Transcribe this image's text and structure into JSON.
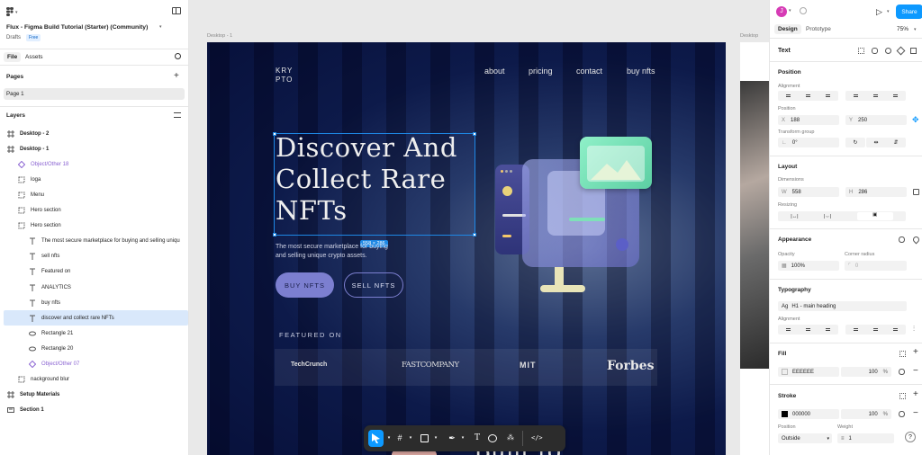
{
  "file": {
    "title": "Flux - Figma Build Tutorial (Starter) (Community)",
    "location": "Drafts",
    "plan_badge": "Free"
  },
  "left_tabs": [
    "File",
    "Assets"
  ],
  "pages": {
    "header": "Pages",
    "items": [
      "Page 1"
    ]
  },
  "layers": {
    "header": "Layers",
    "items": [
      {
        "label": "Desktop - 2",
        "indent": 0,
        "icon": "frame-icon",
        "bold": true
      },
      {
        "label": "Desktop - 1",
        "indent": 0,
        "icon": "frame-icon",
        "bold": true
      },
      {
        "label": "Object/Other 18",
        "indent": 1,
        "icon": "component-instance-icon",
        "purple": true
      },
      {
        "label": "loga",
        "indent": 1,
        "icon": "group-icon"
      },
      {
        "label": "Menu",
        "indent": 1,
        "icon": "group-icon"
      },
      {
        "label": "Hero section",
        "indent": 1,
        "icon": "group-icon"
      },
      {
        "label": "Hero section",
        "indent": 1,
        "icon": "group-icon"
      },
      {
        "label": "The most secure marketplace for buying and selling uniqu",
        "indent": 2,
        "icon": "text-icon"
      },
      {
        "label": "sell nfts",
        "indent": 2,
        "icon": "text-icon"
      },
      {
        "label": "Featured on",
        "indent": 2,
        "icon": "text-icon"
      },
      {
        "label": "ANALYTICS",
        "indent": 2,
        "icon": "text-icon"
      },
      {
        "label": "buy nfts",
        "indent": 2,
        "icon": "text-icon"
      },
      {
        "label": "discover and collect rare NFTs",
        "indent": 2,
        "icon": "text-icon",
        "selected": true
      },
      {
        "label": "Rectangle 21",
        "indent": 2,
        "icon": "ellipse-icon"
      },
      {
        "label": "Rectangle 20",
        "indent": 2,
        "icon": "ellipse-icon"
      },
      {
        "label": "Object/Other 07",
        "indent": 2,
        "icon": "component-instance-icon",
        "purple": true
      },
      {
        "label": "nackground blur",
        "indent": 1,
        "icon": "group-icon"
      },
      {
        "label": "Setup Materials",
        "indent": 0,
        "icon": "frame-icon",
        "bold": true
      },
      {
        "label": "Section 1",
        "indent": 0,
        "icon": "section-icon",
        "bold": true
      }
    ]
  },
  "canvas": {
    "frame_label_1": "Desktop - 1",
    "frame_label_2": "Desktop"
  },
  "site": {
    "logo": [
      "KRY",
      "PTO"
    ],
    "nav": [
      "about",
      "pricing",
      "contact",
      "buy nfts"
    ],
    "heading": [
      "Discover And",
      "Collect Rare",
      "NFTs"
    ],
    "subtext": [
      "The most secure marketplace for buying",
      "and selling unique crypto assets."
    ],
    "size_badge": "558 × 286",
    "buy_button": "BUY NFTS",
    "sell_button": "SELL NFTS",
    "featured_label": "FEATURED ON",
    "logos": [
      "TechCrunch",
      "FASTCOMPANY",
      "MIT",
      "Forbes"
    ],
    "bottom_partial": "Built to"
  },
  "right": {
    "avatar": "J",
    "share": "Share",
    "tabs": [
      "Design",
      "Prototype"
    ],
    "zoom": "75%",
    "selection_type": "Text",
    "position": {
      "title": "Position",
      "alignment": "Alignment",
      "position_label": "Position",
      "x_label": "X",
      "x": "188",
      "y_label": "Y",
      "y": "250",
      "transform_group": "Transform group",
      "rotation": "0°"
    },
    "layout": {
      "title": "Layout",
      "dimensions": "Dimensions",
      "w_label": "W",
      "w": "558",
      "h_label": "H",
      "h": "286",
      "resizing": "Resizing"
    },
    "appearance": {
      "title": "Appearance",
      "opacity_label": "Opacity",
      "opacity": "100%",
      "radius_label": "Corner radius",
      "radius": "0"
    },
    "typography": {
      "title": "Typography",
      "style": "H1 - main heading",
      "alignment": "Alignment"
    },
    "fill": {
      "title": "Fill",
      "hex": "EEEEEE",
      "opacity": "100",
      "unit": "%",
      "color": "#eeeeee"
    },
    "stroke": {
      "title": "Stroke",
      "hex": "000000",
      "opacity": "100",
      "unit": "%",
      "color": "#000000",
      "position_label": "Position",
      "position": "Outside",
      "weight_label": "Weight",
      "weight": "1"
    }
  },
  "colors": {
    "accent": "#0d99ff",
    "selection": "#1e88e5",
    "frame_bg": "#0d1a4a",
    "heading": "#eeeeee",
    "button_fill": "#7c7fd0",
    "card_green": "#7ee0b8"
  },
  "help": "?"
}
